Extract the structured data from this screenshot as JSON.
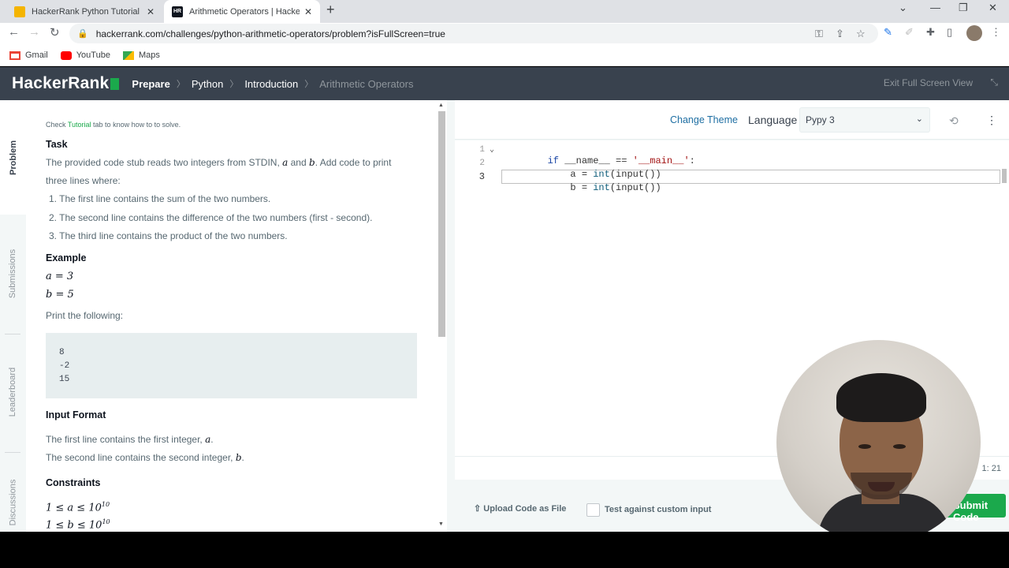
{
  "browser": {
    "tabs": [
      {
        "title": "HackerRank Python Tutorial - Py",
        "active": false,
        "favicon_color": "#f4b400"
      },
      {
        "title": "Arithmetic Operators | HackerRa",
        "active": true,
        "favicon_color": "#0e141e",
        "favicon_text": "HR"
      }
    ],
    "url": "hackerrank.com/challenges/python-arithmetic-operators/problem?isFullScreen=true",
    "bookmarks": [
      {
        "label": "Gmail",
        "icon": "gmail-icon",
        "color": "#ea4335"
      },
      {
        "label": "YouTube",
        "icon": "youtube-icon",
        "color": "#ff0000"
      },
      {
        "label": "Maps",
        "icon": "maps-icon",
        "color": "#34a853"
      }
    ]
  },
  "header": {
    "logo": "HackerRank",
    "breadcrumbs": [
      "Prepare",
      "Python",
      "Introduction",
      "Arithmetic Operators"
    ],
    "exit_label": "Exit Full Screen View"
  },
  "rail": {
    "items": [
      "Problem",
      "Submissions",
      "Leaderboard",
      "Discussions"
    ]
  },
  "problem": {
    "hint_prefix": "Check ",
    "hint_link": "Tutorial",
    "hint_suffix": " tab to know how to to solve.",
    "task_heading": "Task",
    "task_text_1": "The provided code stub reads two integers from STDIN, ",
    "var_a": "a",
    "and_word": " and ",
    "var_b": "b",
    "task_text_2": ". Add code to print",
    "task_text_3": "three lines where:",
    "steps": [
      "1. The first line contains the sum of the two numbers.",
      "2. The second line contains the difference of the two numbers (first - second).",
      "3. The third line contains the product of the two numbers."
    ],
    "example_heading": "Example",
    "example_a": "a = 3",
    "example_b": "b = 5",
    "print_following": "Print the following:",
    "output_lines": [
      "8",
      "-2",
      "15"
    ],
    "input_heading": "Input Format",
    "input_line_1": "The first line contains the first integer, ",
    "input_line_2": "The second line contains the second integer, ",
    "period": ".",
    "constraints_heading": "Constraints",
    "constraint_1_prefix": "1 ≤ a ≤ 10",
    "constraint_2_prefix": "1 ≤ b ≤ 10",
    "exponent": "10"
  },
  "editor": {
    "change_theme": "Change Theme",
    "language_label": "Language",
    "language_value": "Pypy 3",
    "line_numbers": [
      "1",
      "2",
      "3"
    ],
    "lines": [
      {
        "kw": "if",
        "rest": " __name__ == ",
        "str": "'__main__'",
        "end": ":"
      },
      {
        "indent": "    ",
        "var": "a",
        "mid": " = ",
        "fn": "int",
        "rest": "(input())"
      },
      {
        "indent": "    ",
        "var": "b",
        "mid": " = ",
        "fn": "int",
        "rest": "(input())"
      }
    ],
    "cursor_pos": "1: 21",
    "upload_label": "Upload Code as File",
    "test_label": "Test against custom input",
    "submit_label": "Submit Code"
  },
  "colors": {
    "brand_green": "#1ba94c",
    "header_bg": "#39424e",
    "link_blue": "#1f6fa3"
  }
}
